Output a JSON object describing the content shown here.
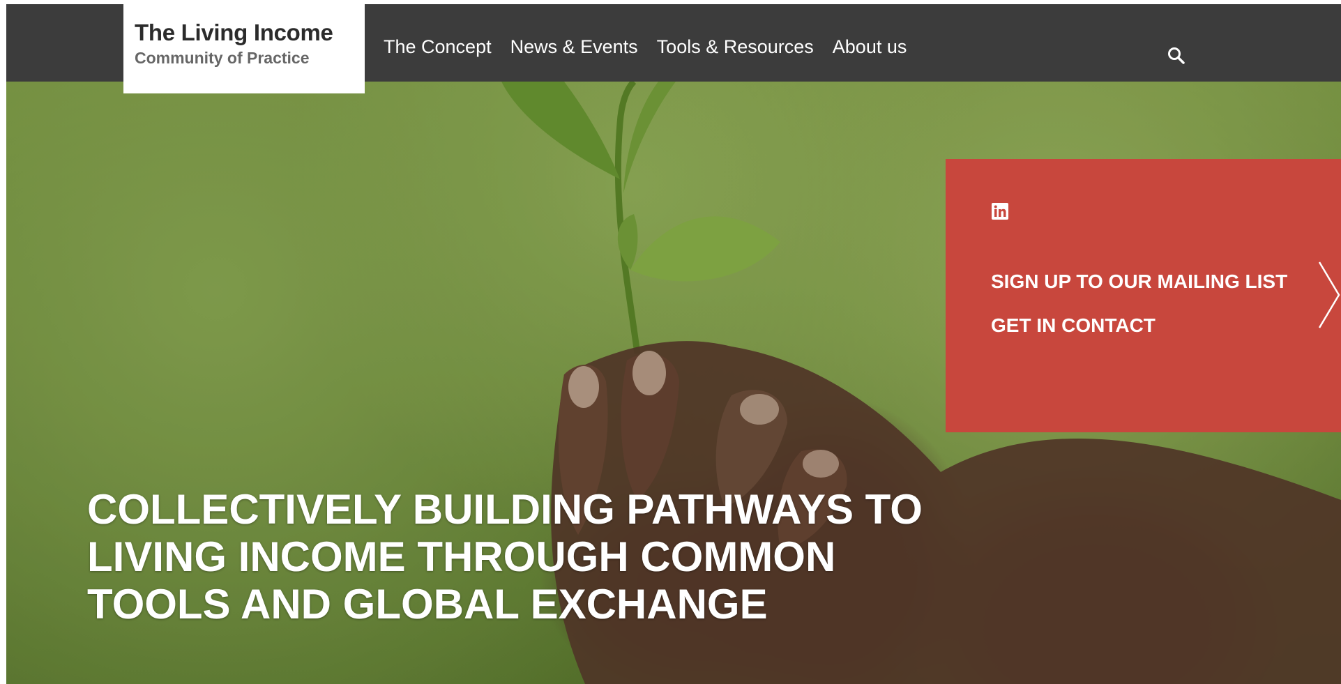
{
  "header": {
    "logo_line1": "The Living Income",
    "logo_line2": "Community of Practice",
    "nav": [
      "The Concept",
      "News & Events",
      "Tools & Resources",
      "About us"
    ],
    "search_icon": "search-icon"
  },
  "hero": {
    "headline": "COLLECTIVELY BUILDING PATHWAYS TO LIVING INCOME THROUGH COMMON TOOLS AND GLOBAL EXCHANGE"
  },
  "panel": {
    "social_icon": "linkedin-icon",
    "mailing_list_label": "SIGN UP TO OUR MAILING LIST",
    "contact_label": "GET IN CONTACT",
    "next_icon": "chevron-right-icon"
  },
  "colors": {
    "header_bg": "#3c3c3c",
    "panel_bg": "#c8473d",
    "text_light": "#ffffff"
  }
}
